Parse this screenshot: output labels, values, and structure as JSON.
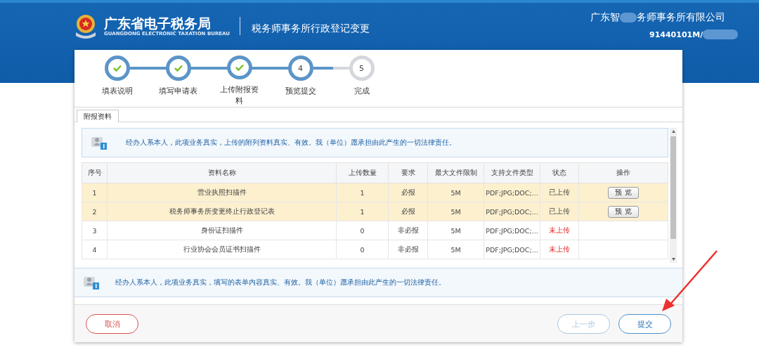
{
  "header": {
    "title": "广东省电子税务局",
    "subtitle": "GUANGDONG ELECTRONIC TAXATION BUREAU",
    "page_title": "税务师事务所行政登记变更",
    "company_parts": [
      "广东智",
      "务师事务所有限公司"
    ],
    "tax_id": "91440101M/"
  },
  "steps": [
    {
      "label": "填表说明",
      "kind": "done"
    },
    {
      "label": "填写申请表",
      "kind": "done"
    },
    {
      "label": "上传附报资料",
      "kind": "done"
    },
    {
      "number": "4",
      "label": "预览提交",
      "kind": "current"
    },
    {
      "number": "5",
      "label": "完成",
      "kind": "pending"
    }
  ],
  "tabs": [
    {
      "label": "附报资料",
      "selected": true
    }
  ],
  "notice_top": "经办人系本人，此项业务真实，上传的附列资料真实、有效。我（单位）愿承担由此产生的一切法律责任。",
  "table": {
    "columns": [
      "序号",
      "资料名称",
      "上传数量",
      "要求",
      "最大文件限制",
      "支持文件类型",
      "状态",
      "操作"
    ],
    "rows": [
      {
        "cells": [
          "1",
          "营业执照扫描件",
          "1",
          "必报",
          "5M",
          "PDF;JPG;DOC;...",
          "已上传"
        ],
        "uploaded": true,
        "highlighted": true,
        "action": "预 览"
      },
      {
        "cells": [
          "2",
          "税务师事务所变更终止行政登记表",
          "1",
          "必报",
          "5M",
          "PDF;JPG;DOC;...",
          "已上传"
        ],
        "uploaded": true,
        "highlighted": true,
        "action": "预 览"
      },
      {
        "cells": [
          "3",
          "身份证扫描件",
          "0",
          "非必报",
          "5M",
          "PDF;JPG;DOC;...",
          "未上传"
        ],
        "uploaded": false,
        "highlighted": false
      },
      {
        "cells": [
          "4",
          "行业协会会员证书扫描件",
          "0",
          "非必报",
          "5M",
          "PDF;JPG;DOC;...",
          "未上传"
        ],
        "uploaded": false,
        "highlighted": false
      }
    ]
  },
  "notice_bottom": "经办人系本人，此项业务真实，填写的表单内容真实、有效。我（单位）愿承担由此产生的一切法律责任。",
  "buttons": [
    {
      "label": "取消",
      "kind": "cancel",
      "disabled": false
    },
    {
      "label": "上一步",
      "kind": "secondary",
      "disabled": true
    },
    {
      "label": "提交",
      "kind": "primary",
      "disabled": false
    }
  ]
}
